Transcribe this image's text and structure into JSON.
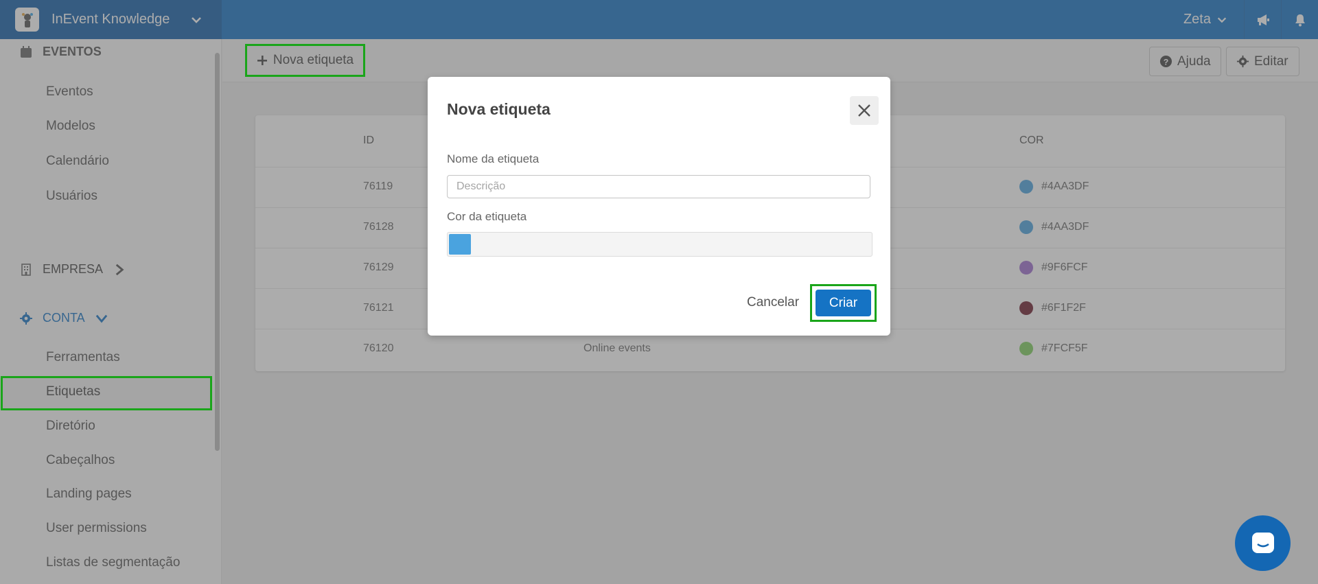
{
  "topbar": {
    "brand": "InEvent Knowledge",
    "user": "Zeta",
    "icons": [
      "megaphone-icon",
      "bell-icon"
    ]
  },
  "sidebar": {
    "events_section": "EVENTOS",
    "events_items": [
      "Eventos",
      "Modelos",
      "Calendário",
      "Usuários"
    ],
    "company_section": "EMPRESA",
    "account_section": "CONTA",
    "account_items": [
      "Ferramentas",
      "Etiquetas",
      "Diretório",
      "Cabeçalhos",
      "Landing pages",
      "User permissions",
      "Listas de segmentação"
    ]
  },
  "toolbar": {
    "new_tag": "Nova etiqueta",
    "help": "Ajuda",
    "edit": "Editar"
  },
  "table": {
    "columns": [
      "ID",
      "COR"
    ],
    "rows": [
      {
        "id": "76119",
        "name": "",
        "color": "#4AA3DF"
      },
      {
        "id": "76128",
        "name": "",
        "color": "#4AA3DF"
      },
      {
        "id": "76129",
        "name": "",
        "color": "#9F6FCF"
      },
      {
        "id": "76121",
        "name": "",
        "color": "#6F1F2F"
      },
      {
        "id": "76120",
        "name": "Online events",
        "color": "#7FCF5F"
      }
    ]
  },
  "modal": {
    "title": "Nova etiqueta",
    "name_label": "Nome da etiqueta",
    "name_placeholder": "Descrição",
    "name_value": "",
    "color_label": "Cor da etiqueta",
    "selected_color": "#4AA3DF",
    "cancel": "Cancelar",
    "create": "Criar"
  },
  "colors": {
    "primary": "#1573c4",
    "highlight": "#1aa51a"
  }
}
